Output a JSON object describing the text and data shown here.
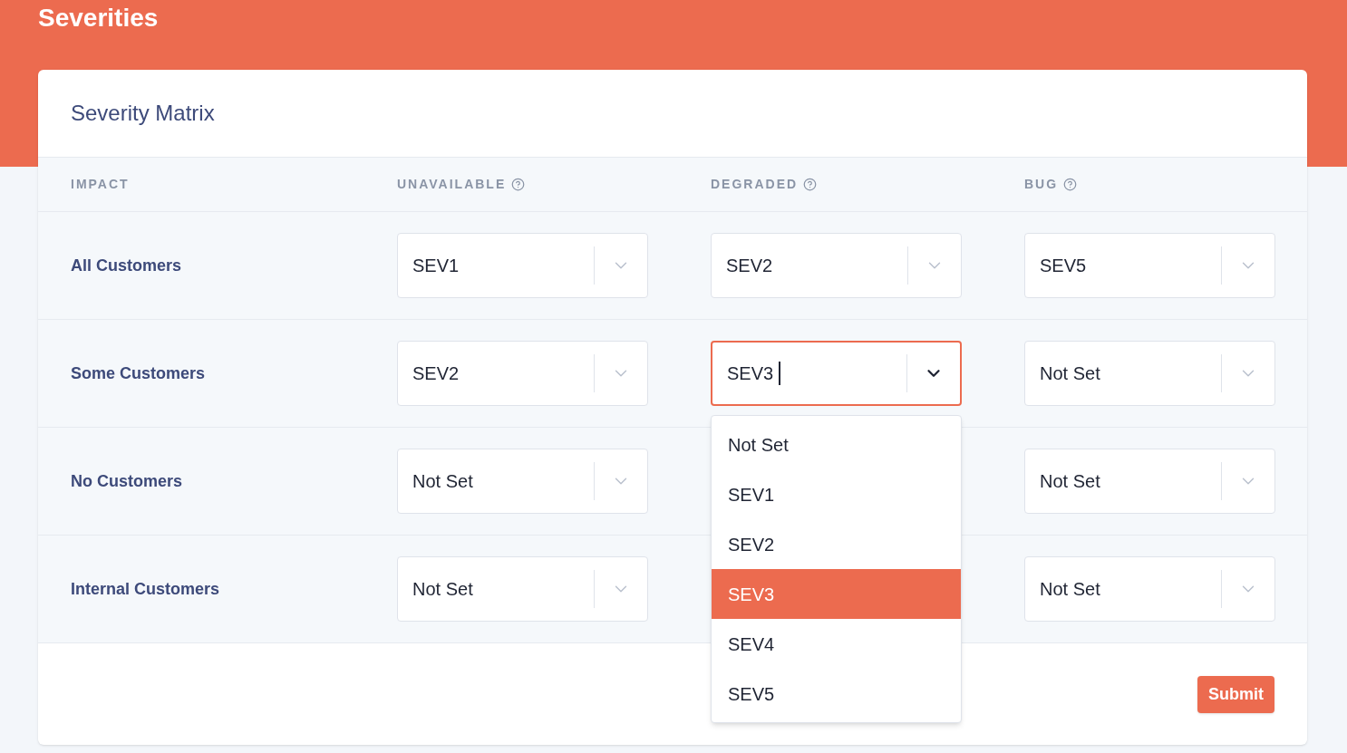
{
  "page_title": "Severities",
  "card_title": "Severity Matrix",
  "columns": [
    {
      "label": "IMPACT",
      "help": false
    },
    {
      "label": "UNAVAILABLE",
      "help": true
    },
    {
      "label": "DEGRADED",
      "help": true
    },
    {
      "label": "BUG",
      "help": true
    }
  ],
  "rows": [
    {
      "label": "All Customers",
      "cells": [
        {
          "value": "SEV1",
          "focused": false
        },
        {
          "value": "SEV2",
          "focused": false
        },
        {
          "value": "SEV5",
          "focused": false
        }
      ]
    },
    {
      "label": "Some Customers",
      "cells": [
        {
          "value": "SEV2",
          "focused": false
        },
        {
          "value": "SEV3",
          "focused": true
        },
        {
          "value": "Not Set",
          "focused": false
        }
      ]
    },
    {
      "label": "No Customers",
      "cells": [
        {
          "value": "Not Set",
          "focused": false
        },
        null,
        {
          "value": "Not Set",
          "focused": false
        }
      ]
    },
    {
      "label": "Internal Customers",
      "cells": [
        {
          "value": "Not Set",
          "focused": false
        },
        null,
        {
          "value": "Not Set",
          "focused": false
        }
      ]
    }
  ],
  "dropdown_options": [
    {
      "label": "Not Set",
      "selected": false
    },
    {
      "label": "SEV1",
      "selected": false
    },
    {
      "label": "SEV2",
      "selected": false
    },
    {
      "label": "SEV3",
      "selected": true
    },
    {
      "label": "SEV4",
      "selected": false
    },
    {
      "label": "SEV5",
      "selected": false
    }
  ],
  "submit_label": "Submit"
}
